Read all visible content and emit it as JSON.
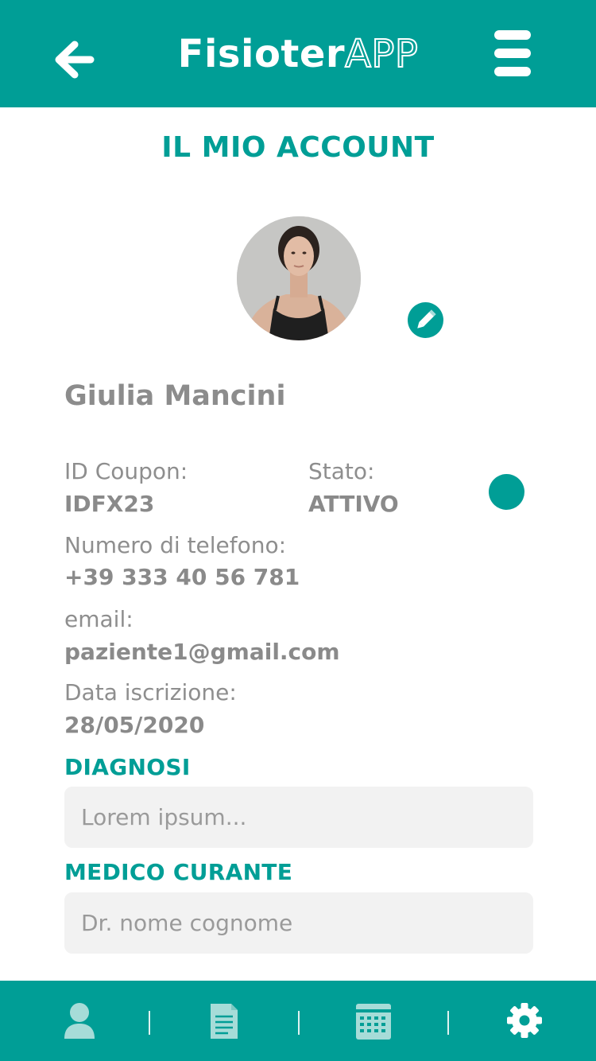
{
  "header": {
    "title_main": "Fisioter",
    "title_accent": "APP",
    "back_icon": "arrow-left-icon",
    "menu_icon": "hamburger-menu-icon"
  },
  "page": {
    "title": "IL MIO ACCOUNT"
  },
  "profile": {
    "name": "Giulia Mancini",
    "edit_icon": "pencil-icon"
  },
  "details": {
    "coupon_label": "ID Coupon:",
    "coupon_value": "IDFX23",
    "status_label": "Stato:",
    "status_value": "ATTIVO",
    "phone_label": "Numero di telefono:",
    "phone_value": "+39 333 40 56 781",
    "email_label": "email:",
    "email_value": "paziente1@gmail.com",
    "signup_label": "Data iscrizione:",
    "signup_value": "28/05/2020"
  },
  "diagnosis": {
    "title": "DIAGNOSI",
    "placeholder": "Lorem ipsum..."
  },
  "doctor": {
    "title": "MEDICO CURANTE",
    "placeholder": "Dr. nome cognome"
  },
  "bottom_nav": {
    "items": [
      {
        "icon": "user-icon",
        "state": "active"
      },
      {
        "icon": "document-icon",
        "state": "active"
      },
      {
        "icon": "calendar-icon",
        "state": "active"
      },
      {
        "icon": "gear-icon",
        "state": "selected"
      }
    ]
  },
  "colors": {
    "brand": "#009e96",
    "text_gray": "#8a8a8a",
    "field_bg": "#f2f2f2",
    "nav_icon_inactive": "#a6dcd8",
    "nav_icon_active": "#ffffff"
  }
}
